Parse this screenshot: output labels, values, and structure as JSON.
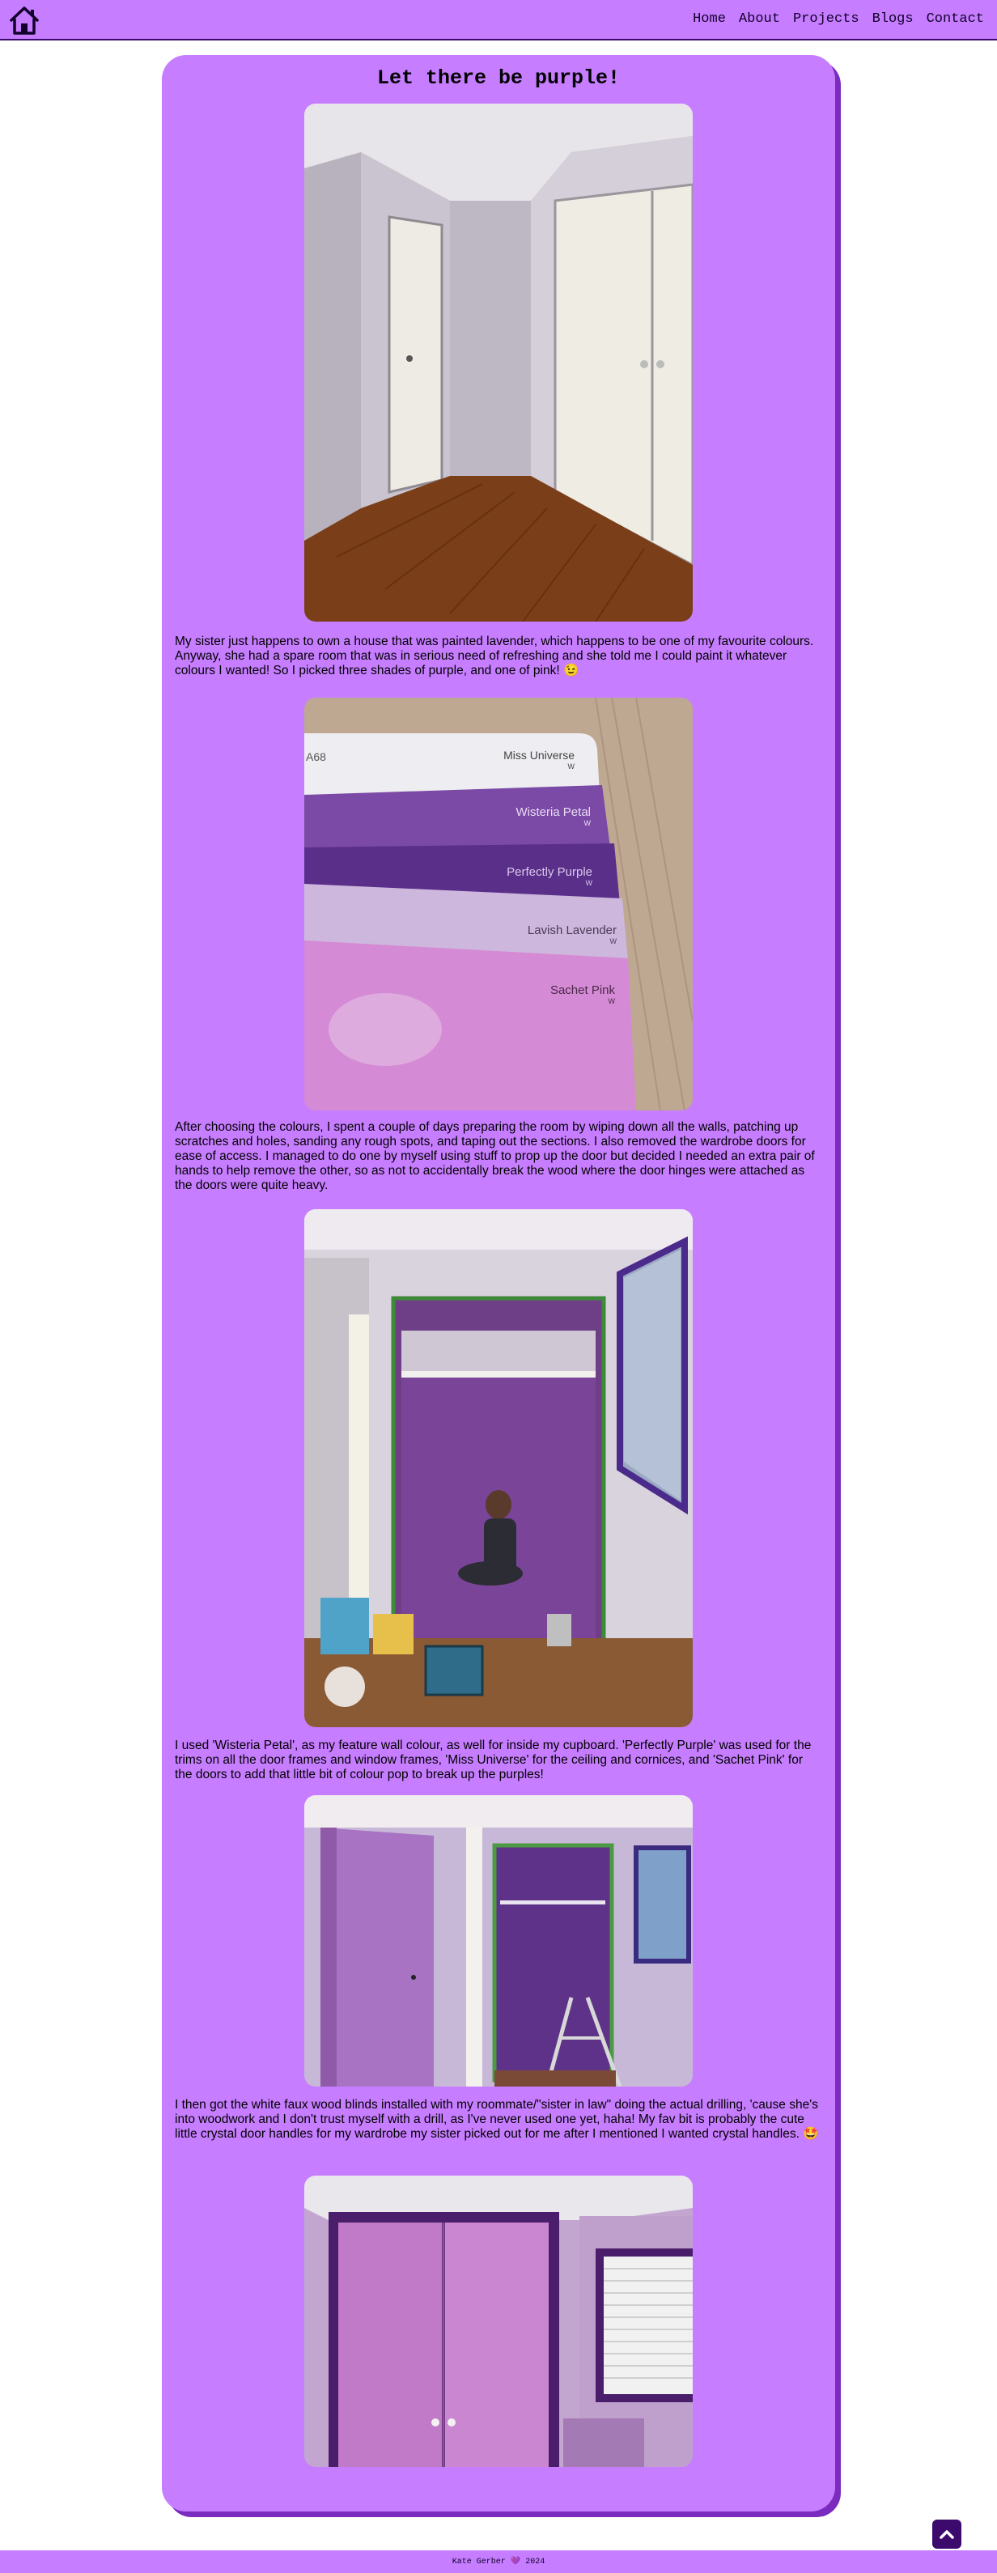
{
  "nav": {
    "home_icon": "house-icon",
    "items": [
      "Home",
      "About",
      "Projects",
      "Blogs",
      "Contact"
    ]
  },
  "post": {
    "title": "Let there be purple!",
    "paragraphs": [
      "My sister just happens to own a house that was painted lavender, which happens to be one of my favourite colours. Anyway, she had a spare room that was in serious need of refreshing and she told me I could paint it whatever colours I wanted! So I picked three shades of purple, and one of pink! 😉",
      "After choosing the colours, I spent a couple of days preparing the room by wiping down all the walls, patching up scratches and holes, sanding any rough spots, and taping out the sections. I also removed the wardrobe doors for ease of access. I managed to do one by myself using stuff to prop up the door but decided I needed an extra pair of hands to help remove the other, so as not to accidentally break the wood where the door hinges were attached as the doors were quite heavy.",
      "I used 'Wisteria Petal', as my feature wall colour, as well for inside my cupboard. 'Perfectly Purple' was used for the trims on all the door frames and window frames, 'Miss Universe' for the ceiling and cornices, and 'Sachet Pink' for the doors to add that little bit of colour pop to break up the purples!",
      "I then got the white faux wood blinds installed with my roommate/\"sister in law\" doing the actual drilling, 'cause she's into woodwork and I don't trust myself with a drill, as I've never used one yet, haha! My fav bit is probably the cute little crystal door handles for my wardrobe my sister picked out for me after I mentioned I wanted crystal handles. 🤩"
    ],
    "swatches": {
      "code": "A68",
      "names": [
        "Miss Universe",
        "Wisteria Petal",
        "Perfectly Purple",
        "Lavish Lavender",
        "Sachet Pink"
      ],
      "suffix": "W"
    }
  },
  "colors": {
    "accent": "#c77dff",
    "shadow": "#7b2cbf",
    "dark": "#3c096c"
  },
  "back_to_top_icon": "chevron-up-icon",
  "footer": {
    "name": "Kate Gerber",
    "heart_icon": "purple-heart-icon",
    "heart": "💜",
    "year": "2024"
  }
}
